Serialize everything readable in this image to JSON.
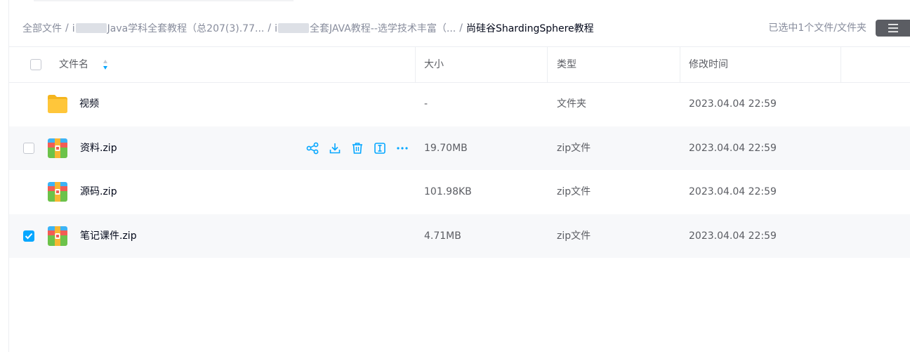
{
  "breadcrumb": {
    "items": [
      {
        "label": "全部文件"
      },
      {
        "label": "Java学科全套教程（总207(3).77..."
      },
      {
        "label": "全套JAVA教程--选学技术丰富（..."
      },
      {
        "label": "尚硅谷ShardingSphere教程"
      }
    ],
    "prefix_2": "i",
    "prefix_3": "i",
    "separator": "/"
  },
  "selection_info": "已选中1个文件/文件夹",
  "table": {
    "columns": {
      "name": "文件名",
      "size": "大小",
      "type": "类型",
      "modified": "修改时间"
    },
    "rows": [
      {
        "name": "视频",
        "size": "-",
        "type": "文件夹",
        "modified": "2023.04.04 22:59",
        "icon": "folder-icon",
        "checked": false
      },
      {
        "name": "资料.zip",
        "size": "19.70MB",
        "type": "zip文件",
        "modified": "2023.04.04 22:59",
        "icon": "zip-icon",
        "checked": false,
        "hover": true
      },
      {
        "name": "源码.zip",
        "size": "101.98KB",
        "type": "zip文件",
        "modified": "2023.04.04 22:59",
        "icon": "zip-icon",
        "checked": false
      },
      {
        "name": "笔记课件.zip",
        "size": "4.71MB",
        "type": "zip文件",
        "modified": "2023.04.04 22:59",
        "icon": "zip-icon",
        "checked": true
      }
    ]
  },
  "row_actions": [
    "share-icon",
    "download-icon",
    "delete-icon",
    "rename-icon",
    "more-icon"
  ],
  "colors": {
    "accent": "#06a7ff",
    "text": "#03081a",
    "muted": "#878c9c",
    "folder": "#ffc63a",
    "row_hover": "#f7f8fa"
  }
}
